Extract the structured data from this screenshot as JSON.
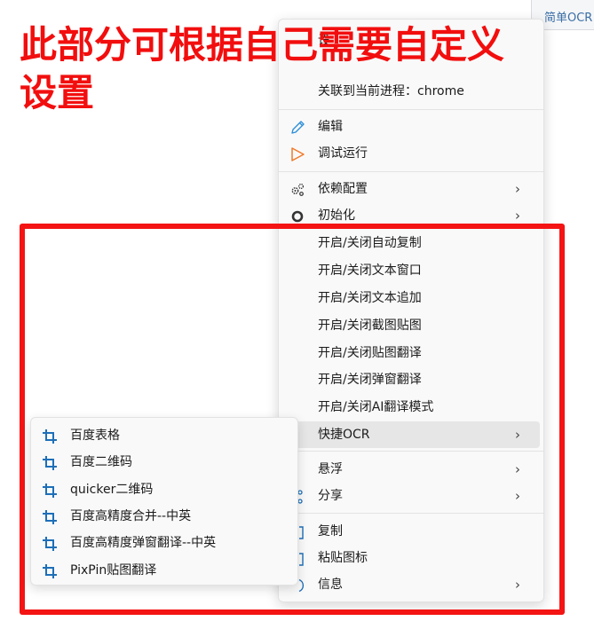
{
  "top_hint": "简单OCR",
  "annotation": {
    "line1": "此部分可根据自己需要自定义",
    "line2": "设置"
  },
  "menu": {
    "partial_top_item": "设",
    "process_item": "关联到当前进程：chrome",
    "edit": "编辑",
    "debug_run": "调试运行",
    "dependency_config": "依赖配置",
    "init": "初始化",
    "custom_items": [
      "开启/关闭自动复制",
      "开启/关闭文本窗口",
      "开启/关闭文本追加",
      "开启/关闭截图贴图",
      "开启/关闭贴图翻译",
      "开启/关闭弹窗翻译",
      "开启/关闭AI翻译模式"
    ],
    "quick_ocr": "快捷OCR",
    "float": "悬浮",
    "share": "分享",
    "copy": "复制",
    "paste_icon": "粘贴图标",
    "info": "信息",
    "arrow": "›"
  },
  "submenu": {
    "items": [
      "百度表格",
      "百度二维码",
      "quicker二维码",
      "百度高精度合并--中英",
      "百度高精度弹窗翻译--中英",
      "PixPin贴图翻译"
    ],
    "item_icon": "crop-icon"
  },
  "colors": {
    "annotation_red": "#f20e0e",
    "icon_blue": "#1d6fb8",
    "edit_blue": "#2f8fd8",
    "run_orange": "#f07a2a"
  }
}
